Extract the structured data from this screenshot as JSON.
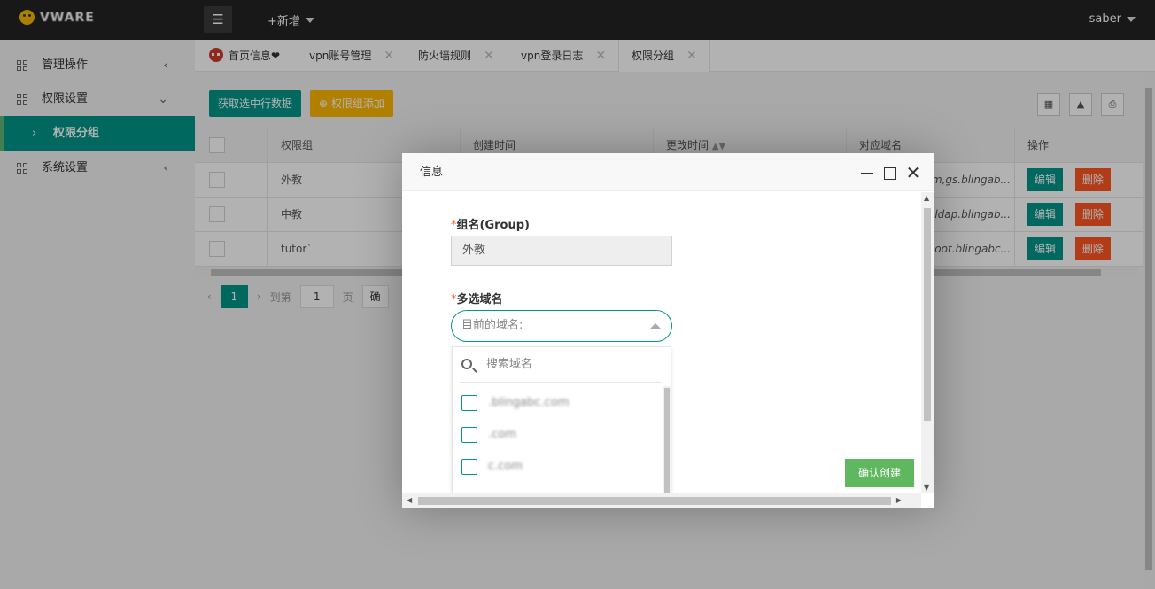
{
  "topbar": {
    "logo_text": "VWARE",
    "new_label": "+新增",
    "user": "saber"
  },
  "sidebar": {
    "items": [
      {
        "label": "管理操作"
      },
      {
        "label": "权限设置"
      },
      {
        "label": "权限分组"
      },
      {
        "label": "系统设置"
      }
    ]
  },
  "tabs": [
    {
      "label": "首页信息❤"
    },
    {
      "label": "vpn账号管理"
    },
    {
      "label": "防火墙规则"
    },
    {
      "label": "vpn登录日志"
    },
    {
      "label": "权限分组"
    }
  ],
  "toolbar": {
    "get_selected": "获取选中行数据",
    "add_group": "⊕ 权限组添加"
  },
  "table": {
    "headers": [
      "权限组",
      "创建时间",
      "更改时间",
      "对应域名",
      "操作"
    ],
    "rows": [
      {
        "group": "外教",
        "domains": "c.com,gs.blingab..."
      },
      {
        "group": "中教",
        "domains": "c.com,ldap.blingab..."
      },
      {
        "group": "tutor`",
        "domains": "n,shoot.blingabc..."
      }
    ],
    "edit_label": "编辑",
    "delete_label": "删除"
  },
  "pager": {
    "current": "1",
    "goto_label": "到第",
    "page_value": "1",
    "page_unit": "页",
    "confirm_label": "确"
  },
  "modal": {
    "title": "信息",
    "group_label": "组名(Group)",
    "group_value": "外教",
    "domains_label": "多选域名",
    "select_placeholder": "目前的域名:",
    "search_placeholder": "搜索域名",
    "options": [
      {
        "label": "         .blingabc.com"
      },
      {
        "label": "         .com"
      },
      {
        "label": "         c.com"
      }
    ],
    "confirm": "确认创建"
  },
  "colors": {
    "primary": "#009688",
    "orange": "#ffb800",
    "danger": "#ff5722",
    "confirm_green": "#5fb85f",
    "topbar": "#232323"
  }
}
